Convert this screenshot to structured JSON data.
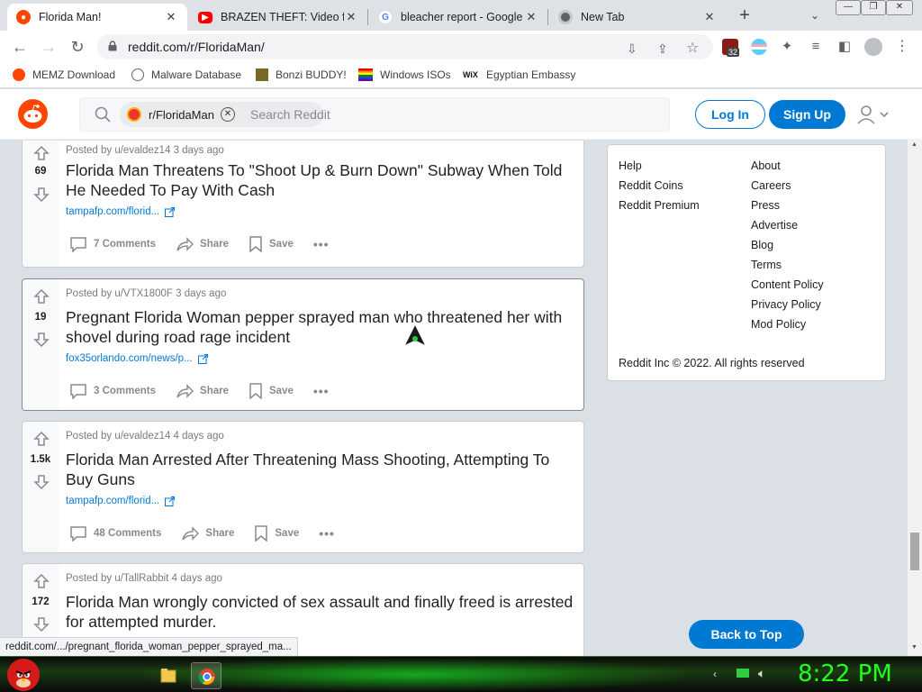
{
  "browser": {
    "tabs": [
      {
        "title": "Florida Man!",
        "active": true
      },
      {
        "title": "BRAZEN THEFT: Video fro",
        "active": false
      },
      {
        "title": "bleacher report - Google",
        "active": false
      },
      {
        "title": "New Tab",
        "active": false
      }
    ],
    "url": "reddit.com/r/FloridaMan/",
    "extension_badge": "32",
    "bookmarks": [
      "MEMZ Download",
      "Malware Database",
      "Bonzi BUDDY!",
      "Windows ISOs",
      "Egyptian Embassy"
    ],
    "status_url": "reddit.com/.../pregnant_florida_woman_pepper_sprayed_ma..."
  },
  "reddit": {
    "search": {
      "chip": "r/FloridaMan",
      "placeholder": "Search Reddit"
    },
    "login_label": "Log In",
    "signup_label": "Sign Up",
    "back_to_top": "Back to Top",
    "brand_color": "#ff4500",
    "accent_color": "#0079d3"
  },
  "posts": [
    {
      "score": "69",
      "meta": "Posted by u/evaldez14 3 days ago",
      "title": "Florida Man Threatens To \"Shoot Up & Burn Down\" Subway When Told He Needed To Pay With Cash",
      "link": "tampafp.com/florid...",
      "comments": "7 Comments",
      "share": "Share",
      "save": "Save"
    },
    {
      "score": "19",
      "meta": "Posted by u/VTX1800F 3 days ago",
      "title": "Pregnant Florida Woman pepper sprayed man who threatened her with shovel during road rage incident",
      "link": "fox35orlando.com/news/p...",
      "comments": "3 Comments",
      "share": "Share",
      "save": "Save"
    },
    {
      "score": "1.5k",
      "meta": "Posted by u/evaldez14 4 days ago",
      "title": "Florida Man Arrested After Threatening Mass Shooting, Attempting To Buy Guns",
      "link": "tampafp.com/florid...",
      "comments": "48 Comments",
      "share": "Share",
      "save": "Save"
    },
    {
      "score": "172",
      "meta": "Posted by u/TallRabbit 4 days ago",
      "title": "Florida Man wrongly convicted of sex assault and finally freed is arrested for attempted murder."
    }
  ],
  "sidebar": {
    "left_links": [
      "Help",
      "Reddit Coins",
      "Reddit Premium"
    ],
    "right_links": [
      "About",
      "Careers",
      "Press",
      "Advertise",
      "Blog",
      "Terms",
      "Content Policy",
      "Privacy Policy",
      "Mod Policy"
    ],
    "copyright": "Reddit Inc © 2022. All rights reserved"
  },
  "taskbar": {
    "clock": "8:22 PM"
  }
}
